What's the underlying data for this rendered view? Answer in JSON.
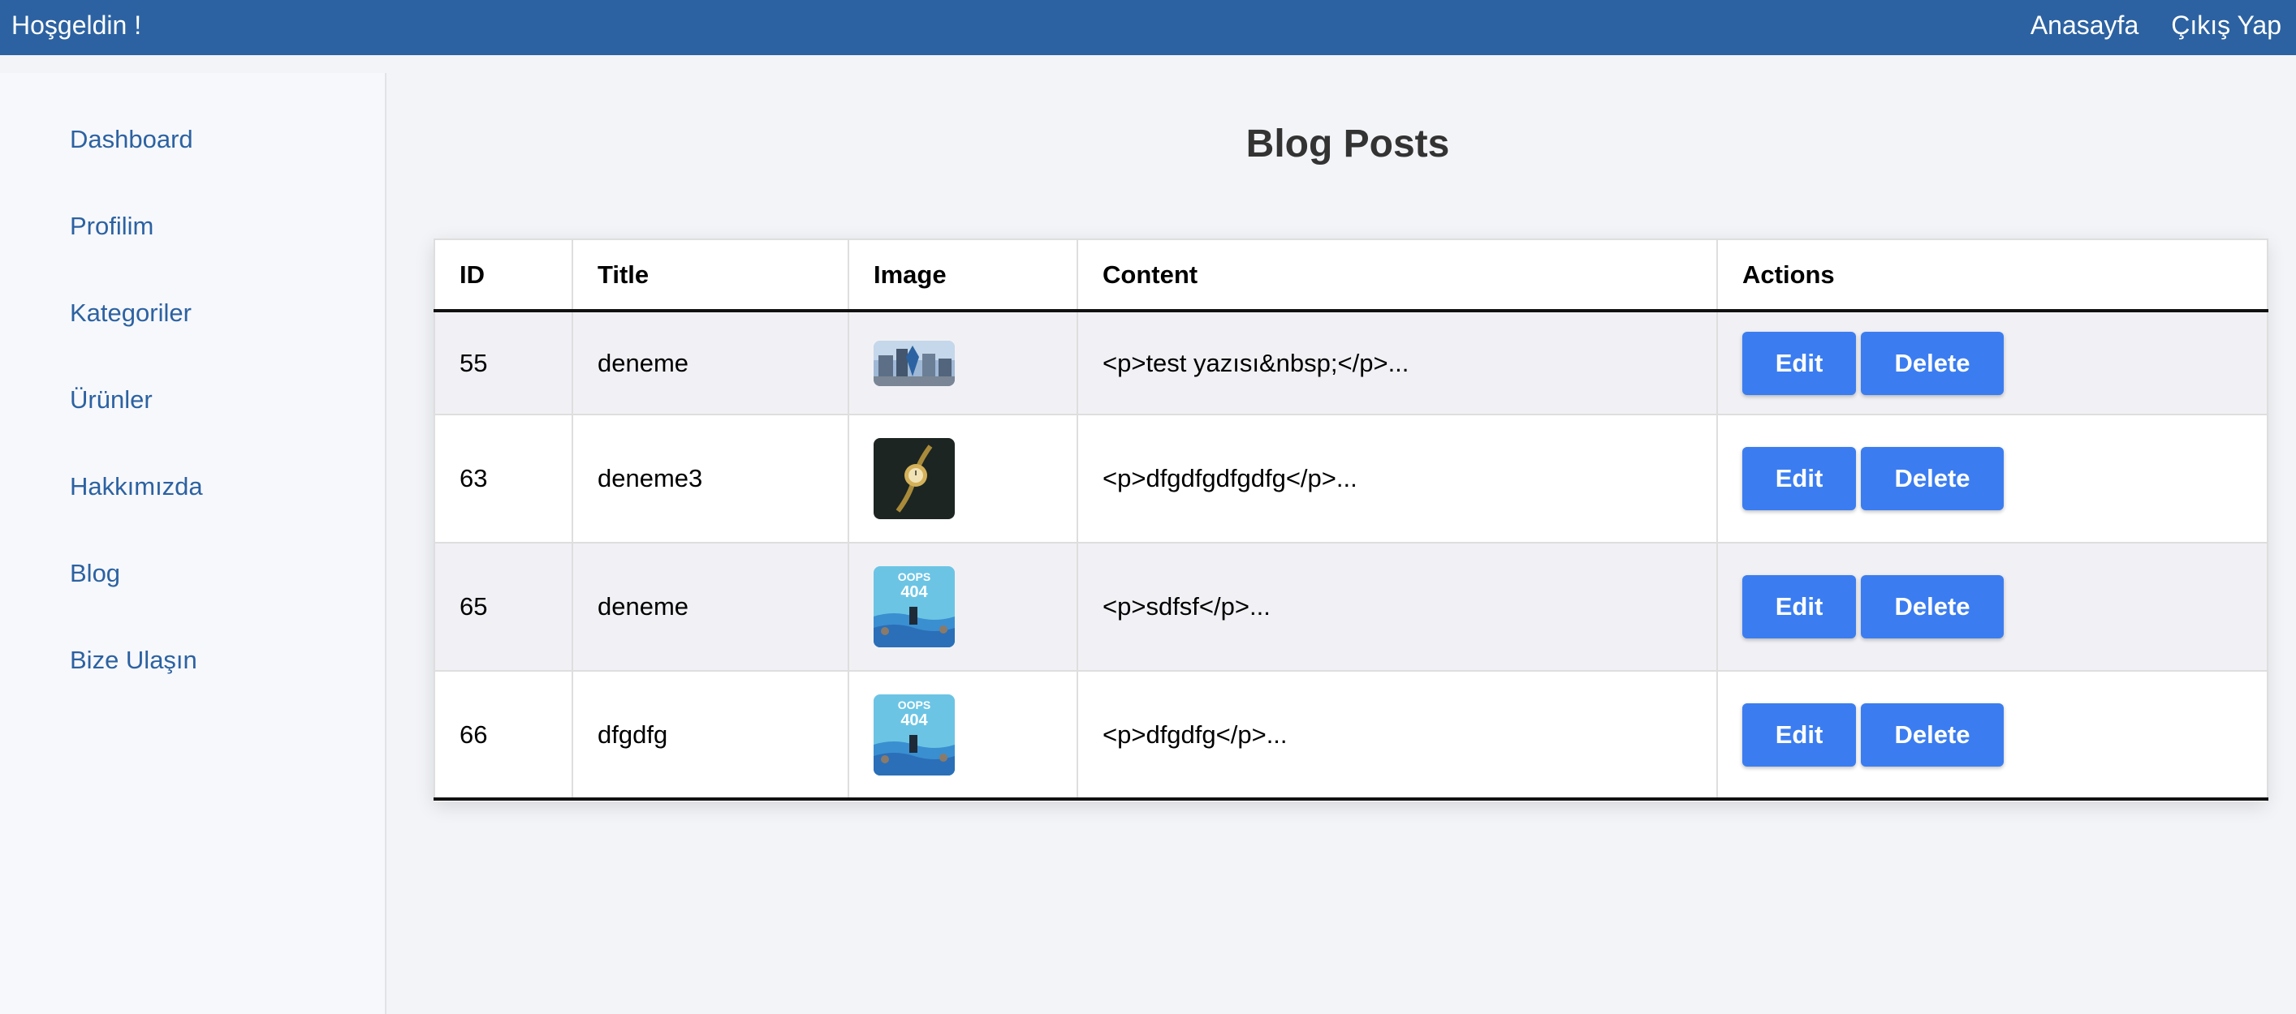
{
  "header": {
    "welcome": "Hoşgeldin !",
    "nav": [
      "Anasayfa",
      "Çıkış Yap"
    ]
  },
  "sidebar": {
    "items": [
      "Dashboard",
      "Profilim",
      "Kategoriler",
      "Ürünler",
      "Hakkımızda",
      "Blog",
      "Bize Ulaşın"
    ]
  },
  "main": {
    "title": "Blog Posts",
    "columns": [
      "ID",
      "Title",
      "Image",
      "Content",
      "Actions"
    ],
    "rows": [
      {
        "id": "55",
        "title": "deneme",
        "image": "city-photo-thumbnail",
        "content": "<p>test yazısı&nbsp;</p>..."
      },
      {
        "id": "63",
        "title": "deneme3",
        "image": "watch-photo-thumbnail",
        "content": "<p>dfgdfgdfgdfg</p>..."
      },
      {
        "id": "65",
        "title": "deneme",
        "image": "oops-404-thumbnail",
        "content": "<p>sdfsf</p>...",
        "image_text": [
          "OOPS",
          "404"
        ]
      },
      {
        "id": "66",
        "title": "dfgdfg",
        "image": "oops-404-thumbnail",
        "content": "<p>dfgdfg</p>...",
        "image_text": [
          "OOPS",
          "404"
        ]
      }
    ],
    "actions": {
      "edit": "Edit",
      "delete": "Delete"
    }
  },
  "colors": {
    "header_bg": "#2c62a1",
    "link": "#2c62a1",
    "button": "#3b7df0",
    "page_bg": "#f3f4f8"
  }
}
